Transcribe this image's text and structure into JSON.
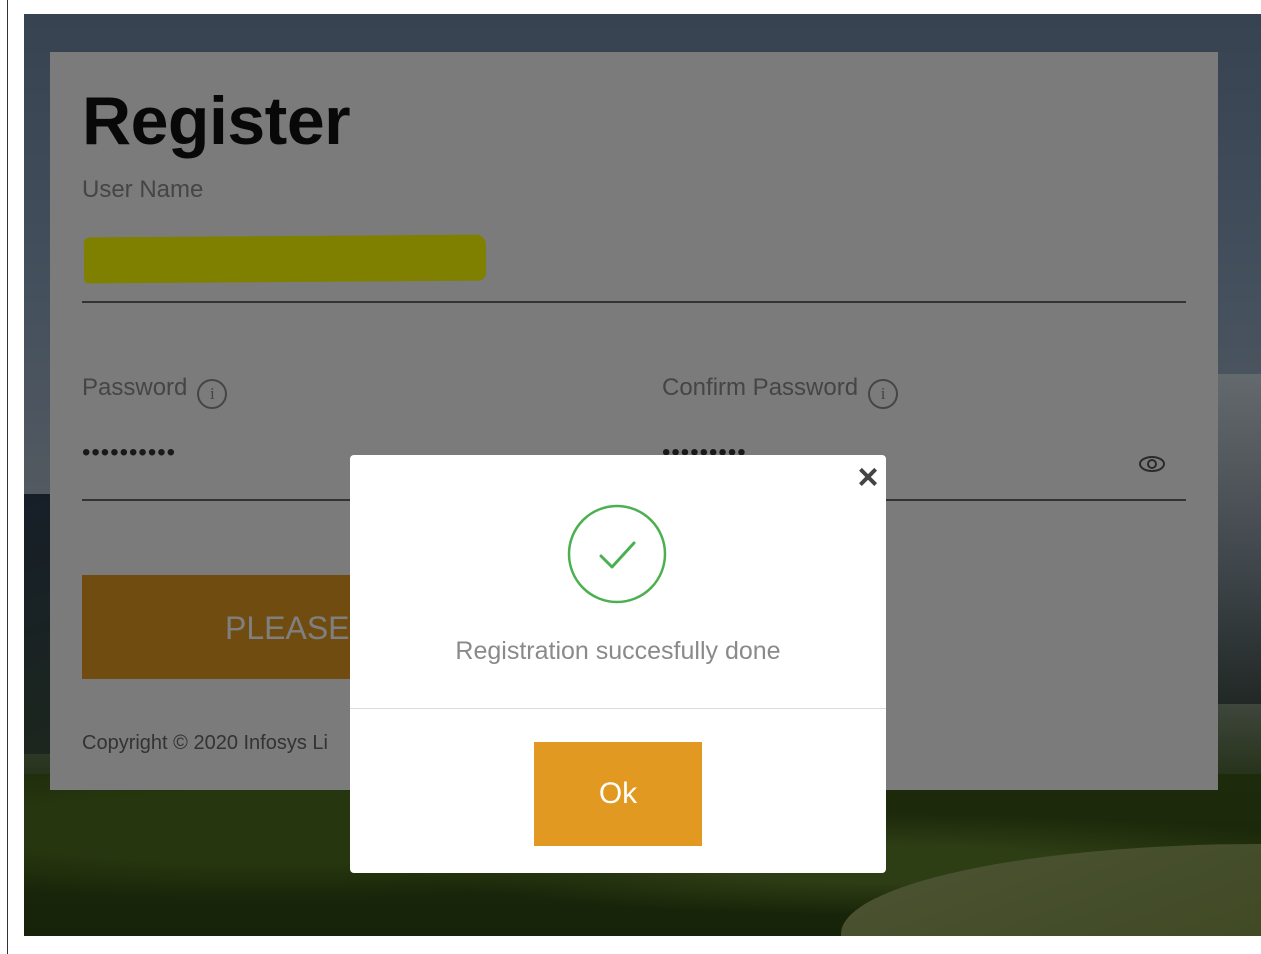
{
  "register": {
    "title": "Register",
    "username_label": "User Name",
    "password_label": "Password",
    "password_value": "••••••••••",
    "confirm_password_label": "Confirm Password",
    "confirm_password_value": "•••••••••",
    "submit_label": "PLEASE",
    "copyright": "Copyright © 2020 Infosys Li"
  },
  "icons": {
    "info": "i",
    "eye": "eye-icon",
    "close": "×"
  },
  "modal": {
    "message": "Registration succesfully done",
    "ok_label": "Ok"
  },
  "colors": {
    "accent": "#e19921",
    "highlight": "#ffff00",
    "success": "#4caf50"
  }
}
